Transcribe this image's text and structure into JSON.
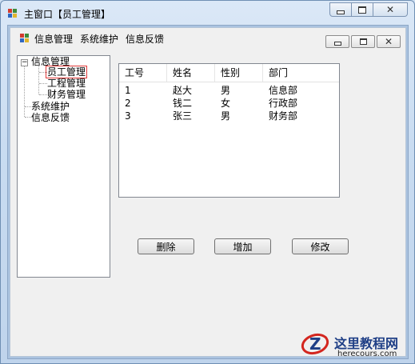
{
  "window": {
    "title": "主窗口【员工管理】"
  },
  "menu": {
    "items": [
      "信息管理",
      "系统维护",
      "信息反馈"
    ]
  },
  "tree": {
    "root": "信息管理",
    "children": [
      "员工管理",
      "工程管理",
      "财务管理"
    ],
    "selected": "员工管理",
    "siblings": [
      "系统维护",
      "信息反馈"
    ]
  },
  "table": {
    "headers": [
      "工号",
      "姓名",
      "性别",
      "部门"
    ],
    "rows": [
      [
        "1",
        "赵大",
        "男",
        "信息部"
      ],
      [
        "2",
        "钱二",
        "女",
        "行政部"
      ],
      [
        "3",
        "张三",
        "男",
        "财务部"
      ]
    ]
  },
  "buttons": {
    "delete": "删除",
    "add": "增加",
    "edit": "修改"
  },
  "watermark": {
    "title": "这里教程网",
    "url": "herecours.com"
  },
  "icons": {
    "app": "app-icon",
    "menu": "mdi-child-icon"
  },
  "colors": {
    "selection_border": "#e23a3a",
    "watermark_blue": "#1f3f86",
    "watermark_red": "#d3261f"
  }
}
